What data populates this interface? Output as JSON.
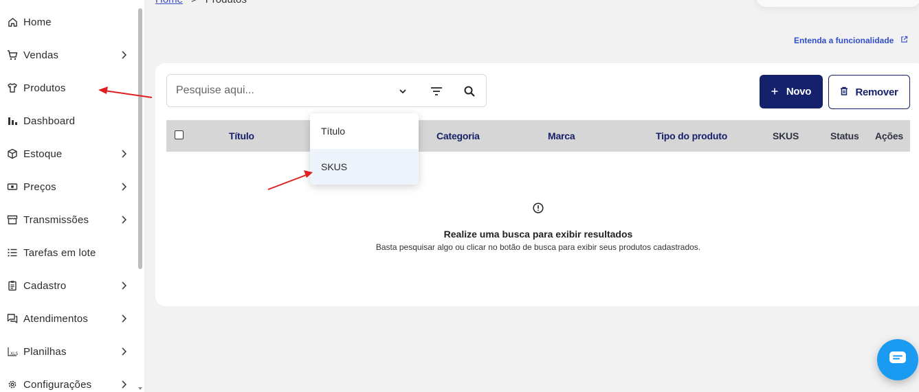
{
  "sidebar": {
    "items": [
      {
        "label": "Home",
        "icon": "home-icon",
        "chevron": false
      },
      {
        "label": "Vendas",
        "icon": "cart-icon",
        "chevron": true
      },
      {
        "label": "Produtos",
        "icon": "shirt-icon",
        "chevron": false
      },
      {
        "label": "Dashboard",
        "icon": "bar-chart-icon",
        "chevron": false
      },
      {
        "label": "Estoque",
        "icon": "box-icon",
        "chevron": true
      },
      {
        "label": "Preços",
        "icon": "money-icon",
        "chevron": true
      },
      {
        "label": "Transmissões",
        "icon": "store-icon",
        "chevron": true
      },
      {
        "label": "Tarefas em lote",
        "icon": "list-icon",
        "chevron": false
      },
      {
        "label": "Cadastro",
        "icon": "clipboard-icon",
        "chevron": true
      },
      {
        "label": "Atendimentos",
        "icon": "chat-icon",
        "chevron": true
      },
      {
        "label": "Planilhas",
        "icon": "xls-icon",
        "chevron": true
      },
      {
        "label": "Configurações",
        "icon": "gear-icon",
        "chevron": true
      }
    ]
  },
  "breadcrumb": {
    "home": "Home",
    "separator": ">",
    "current": "Produtos"
  },
  "help_link": "Entenda a funcionalidade",
  "search": {
    "placeholder": "Pesquise aqui..."
  },
  "buttons": {
    "novo": "Novo",
    "remover": "Remover"
  },
  "table": {
    "columns": [
      "Título",
      "Categoria",
      "Marca",
      "Tipo do produto",
      "SKUS",
      "Status",
      "Ações"
    ]
  },
  "dropdown": {
    "options": [
      "Título",
      "SKUS"
    ],
    "highlighted": "SKUS"
  },
  "empty_state": {
    "title": "Realize uma busca para exibir resultados",
    "subtitle": "Basta pesquisar algo ou clicar no botão de busca para exibir seus produtos cadastrados."
  },
  "colors": {
    "primary": "#15226b",
    "link": "#2f4fc7",
    "chat": "#1a9af0",
    "annotation": "#e02020"
  }
}
